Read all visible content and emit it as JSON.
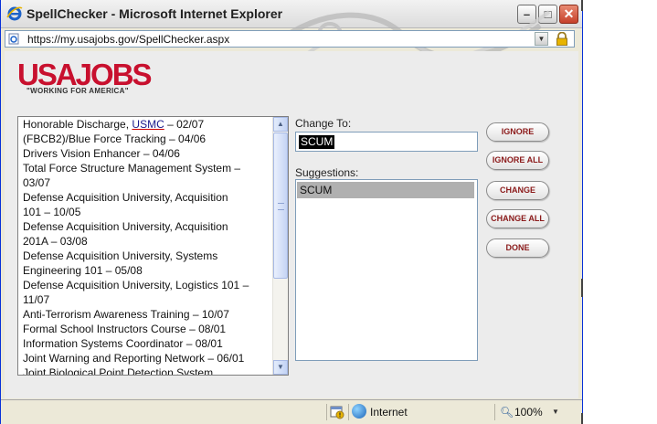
{
  "window": {
    "title": "SpellChecker - Microsoft Internet Explorer",
    "url": "https://my.usajobs.gov/SpellChecker.aspx"
  },
  "logo": {
    "wordmark": "USAJOBS",
    "tagline": "\"WORKING FOR AMERICA\""
  },
  "text_lines": [
    {
      "pre": "Honorable Discharge, ",
      "flag": "USMC",
      "post": " – 02/07"
    },
    {
      "pre": "(FBCB2)/Blue Force Tracking – 04/06"
    },
    {
      "pre": "Drivers Vision Enhancer – 04/06"
    },
    {
      "pre": "Total Force Structure Management System –"
    },
    {
      "pre": "03/07"
    },
    {
      "pre": "Defense Acquisition University, Acquisition"
    },
    {
      "pre": "101 – 10/05"
    },
    {
      "pre": "Defense Acquisition University, Acquisition"
    },
    {
      "pre": "201A – 03/08"
    },
    {
      "pre": "Defense Acquisition University, Systems"
    },
    {
      "pre": "Engineering 101 – 05/08"
    },
    {
      "pre": "Defense Acquisition University, Logistics 101 –"
    },
    {
      "pre": "11/07"
    },
    {
      "pre": "Anti-Terrorism Awareness Training – 10/07"
    },
    {
      "pre": "Formal School Instructors Course – 08/01"
    },
    {
      "pre": "Information Systems Coordinator – 08/01"
    },
    {
      "pre": "Joint Warning and Reporting Network – 06/01"
    },
    {
      "pre": "Joint Biological Point Detection System"
    }
  ],
  "change_to": {
    "label": "Change To:",
    "value": "SCUM"
  },
  "suggestions": {
    "label": "Suggestions:",
    "items": [
      "SCUM"
    ]
  },
  "buttons": {
    "ignore": "IGNORE",
    "ignore_all": "IGNORE ALL",
    "change": "CHANGE",
    "change_all": "CHANGE ALL",
    "done": "DONE"
  },
  "status": {
    "zone": "Internet",
    "zoom": "100%"
  },
  "icons": [
    "ie-icon",
    "page-icon",
    "lock-icon",
    "minimize-icon",
    "maximize-icon",
    "close-icon",
    "popup-blocked-icon",
    "globe-icon",
    "zoom-icon"
  ]
}
